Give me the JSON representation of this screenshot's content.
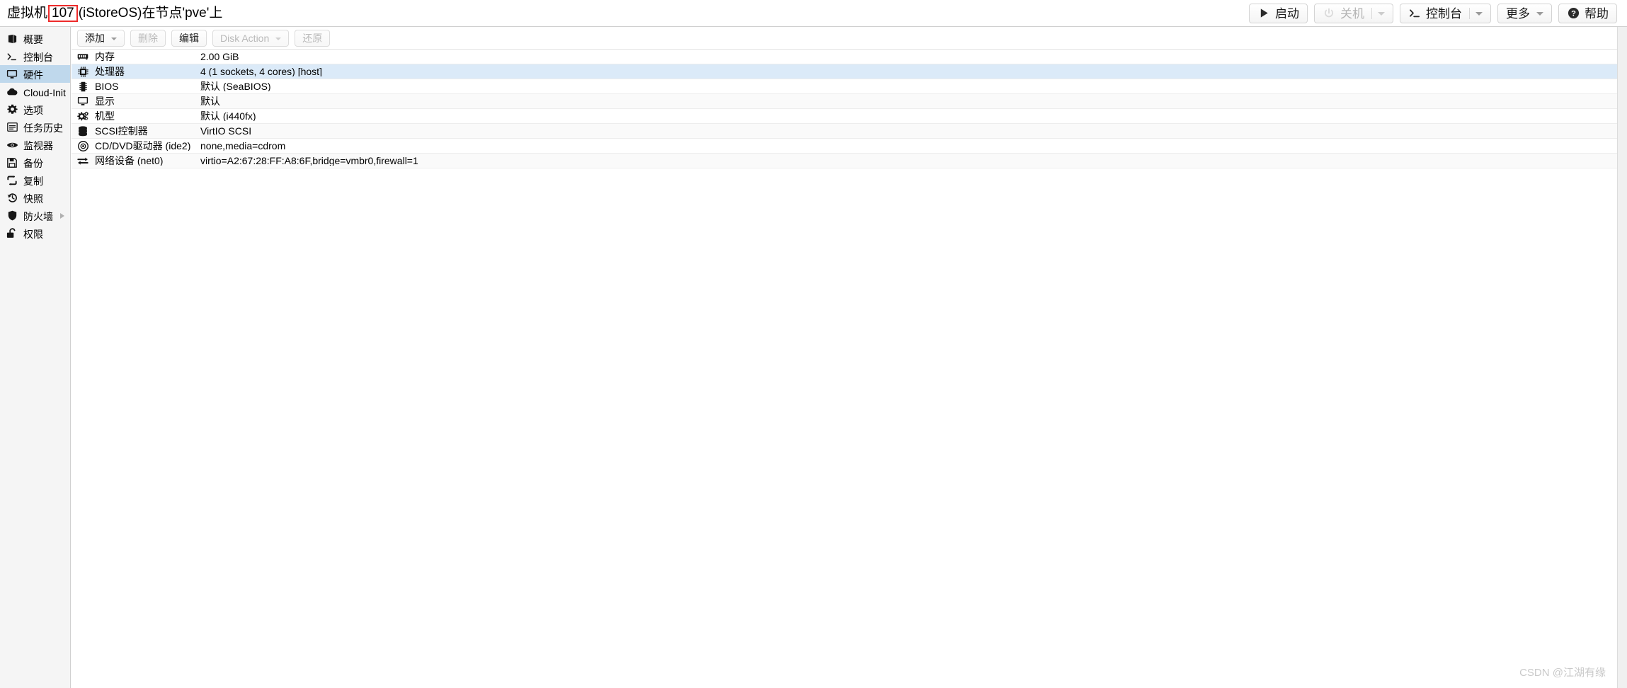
{
  "header": {
    "title_prefix": "虚拟机",
    "title_vmid": "107",
    "title_suffix": "(iStoreOS)在节点'pve'上",
    "buttons": [
      {
        "label": "启动",
        "icon": "play-icon",
        "disabled": false,
        "split_caret": false
      },
      {
        "label": "关机",
        "icon": "power-icon",
        "disabled": true,
        "split_caret": true
      },
      {
        "label": "控制台",
        "icon": "terminal-icon",
        "disabled": false,
        "split_caret": true
      },
      {
        "label": "更多",
        "icon": "none",
        "disabled": false,
        "split_caret": false,
        "caret": true
      },
      {
        "label": "帮助",
        "icon": "help-icon",
        "disabled": false,
        "split_caret": false
      }
    ]
  },
  "sidebar": {
    "items": [
      {
        "label": "概要",
        "icon": "book-icon",
        "selected": false,
        "arrow": false
      },
      {
        "label": "控制台",
        "icon": "terminal-icon",
        "selected": false,
        "arrow": false
      },
      {
        "label": "硬件",
        "icon": "monitor-icon",
        "selected": true,
        "arrow": false
      },
      {
        "label": "Cloud-Init",
        "icon": "cloud-icon",
        "selected": false,
        "arrow": false
      },
      {
        "label": "选项",
        "icon": "gear-icon",
        "selected": false,
        "arrow": false
      },
      {
        "label": "任务历史",
        "icon": "list-icon",
        "selected": false,
        "arrow": false
      },
      {
        "label": "监视器",
        "icon": "eye-icon",
        "selected": false,
        "arrow": false
      },
      {
        "label": "备份",
        "icon": "floppy-icon",
        "selected": false,
        "arrow": false
      },
      {
        "label": "复制",
        "icon": "refresh-icon",
        "selected": false,
        "arrow": false
      },
      {
        "label": "快照",
        "icon": "history-icon",
        "selected": false,
        "arrow": false
      },
      {
        "label": "防火墙",
        "icon": "shield-icon",
        "selected": false,
        "arrow": true
      },
      {
        "label": "权限",
        "icon": "unlock-icon",
        "selected": false,
        "arrow": false
      }
    ]
  },
  "toolbar": {
    "buttons": [
      {
        "label": "添加",
        "disabled": false,
        "caret": true
      },
      {
        "label": "删除",
        "disabled": true,
        "caret": false
      },
      {
        "label": "编辑",
        "disabled": false,
        "caret": false
      },
      {
        "label": "Disk Action",
        "disabled": true,
        "caret": true
      },
      {
        "label": "还原",
        "disabled": true,
        "caret": false
      }
    ]
  },
  "hardware": {
    "rows": [
      {
        "icon": "memory-icon",
        "key": "内存",
        "value": "2.00 GiB",
        "selected": false,
        "alt": false
      },
      {
        "icon": "cpu-icon",
        "key": "处理器",
        "value": "4 (1 sockets, 4 cores) [host]",
        "selected": true,
        "alt": false
      },
      {
        "icon": "chip-icon",
        "key": "BIOS",
        "value": "默认 (SeaBIOS)",
        "selected": false,
        "alt": false
      },
      {
        "icon": "monitor-icon",
        "key": "显示",
        "value": "默认",
        "selected": false,
        "alt": true
      },
      {
        "icon": "gears-icon",
        "key": "机型",
        "value": "默认 (i440fx)",
        "selected": false,
        "alt": false
      },
      {
        "icon": "database-icon",
        "key": "SCSI控制器",
        "value": "VirtIO SCSI",
        "selected": false,
        "alt": true
      },
      {
        "icon": "disc-icon",
        "key": "CD/DVD驱动器 (ide2)",
        "value": "none,media=cdrom",
        "selected": false,
        "alt": false
      },
      {
        "icon": "network-icon",
        "key": "网络设备 (net0)",
        "value": "virtio=A2:67:28:FF:A8:6F,bridge=vmbr0,firewall=1",
        "selected": false,
        "alt": true
      }
    ]
  },
  "watermark": {
    "text": "CSDN @江湖有缘"
  },
  "colors": {
    "selected_row": "#dbeaf8",
    "selected_nav": "#bfd8ec",
    "highlight_box": "#ee2b2b",
    "sidebar_bg": "#f5f5f5",
    "alt_row": "#fafafa"
  }
}
